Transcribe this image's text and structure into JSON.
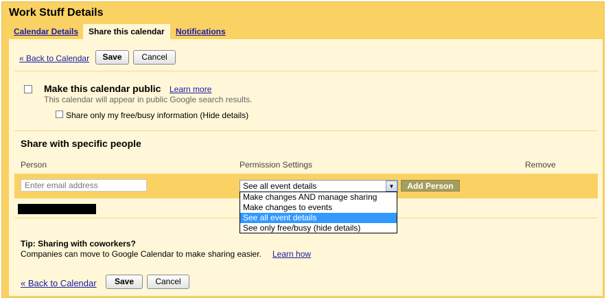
{
  "title": "Work Stuff Details",
  "tabs": [
    {
      "label": "Calendar Details",
      "active": false
    },
    {
      "label": "Share this calendar",
      "active": true
    },
    {
      "label": "Notifications",
      "active": false
    }
  ],
  "top_actions": {
    "back": "« Back to Calendar",
    "save": "Save",
    "cancel": "Cancel"
  },
  "public": {
    "label": "Make this calendar public",
    "learn_more": "Learn more",
    "hint": "This calendar will appear in public Google search results.",
    "freebusy_label": "Share only my free/busy information (Hide details)",
    "checked": false,
    "freebusy_checked": false
  },
  "share_people": {
    "heading": "Share with specific people",
    "col_person": "Person",
    "col_permission": "Permission Settings",
    "col_remove": "Remove",
    "email_placeholder": "Enter email address",
    "permission_selected": "See all event details",
    "permission_options": [
      "Make changes AND manage sharing",
      "Make changes to events",
      "See all event details",
      "See only free/busy (hide details)"
    ],
    "add_person": "Add Person"
  },
  "tip": {
    "title": "Tip: Sharing with coworkers?",
    "text": "Companies can move to Google Calendar to make sharing easier.",
    "link": "Learn how"
  },
  "bottom_actions": {
    "back": "« Back to Calendar",
    "save": "Save",
    "cancel": "Cancel"
  },
  "colors": {
    "frame": "#fad163",
    "panel": "#fff7d7",
    "link": "#1a1aa6",
    "selected": "#3399ff",
    "add_button": "#a59e5f"
  }
}
